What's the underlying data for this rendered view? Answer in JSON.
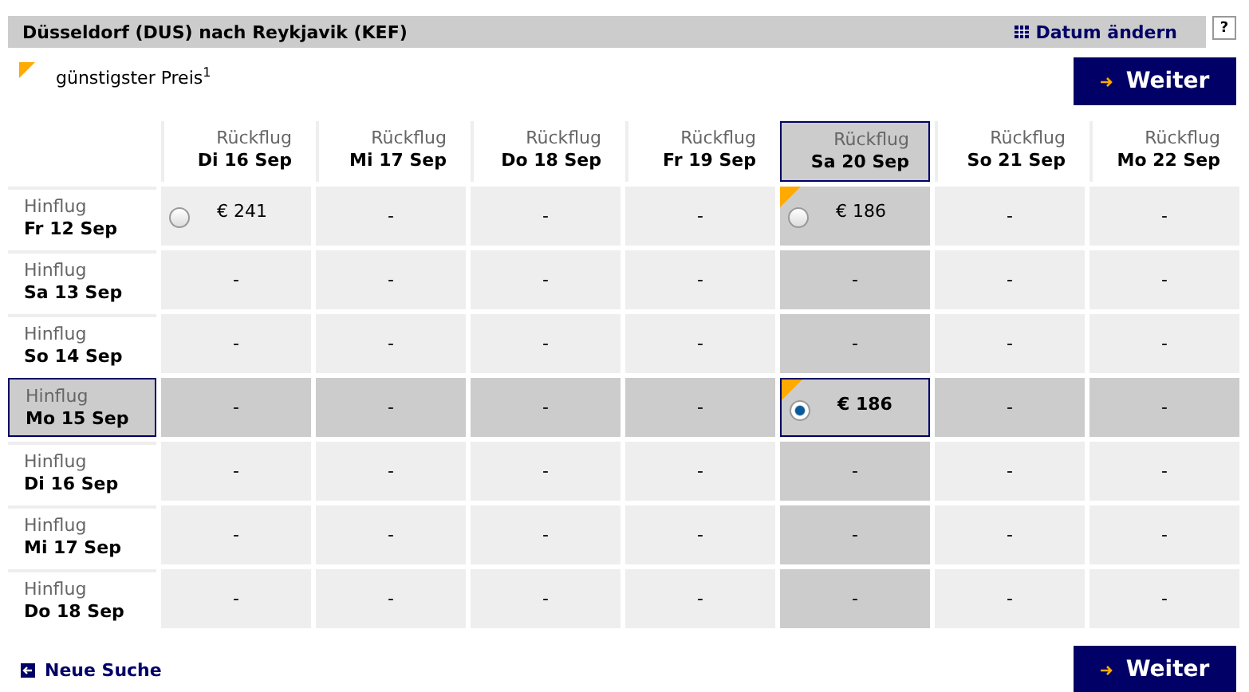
{
  "header": {
    "title": "Düsseldorf (DUS) nach Reykjavik (KEF)",
    "change_date": "Datum ändern",
    "help": "?"
  },
  "legend": {
    "text": "günstigster Preis$^{1}$"
  },
  "continue_top": "Weiter",
  "columns": [
    {
      "label": "Rückflug",
      "date": "Di 16 Sep",
      "selected": false
    },
    {
      "label": "Rückflug",
      "date": "Mi 17 Sep",
      "selected": false
    },
    {
      "label": "Rückflug",
      "date": "Do 18 Sep",
      "selected": false
    },
    {
      "label": "Rückflug",
      "date": "Fr 19 Sep",
      "selected": false
    },
    {
      "label": "Rückflug",
      "date": "Sa 20 Sep",
      "selected": true
    },
    {
      "label": "Rückflug",
      "date": "So 21 Sep",
      "selected": false
    },
    {
      "label": "Rückflug",
      "date": "Mo 22 Sep",
      "selected": false
    }
  ],
  "rows": [
    {
      "label": "Hinflug",
      "date": "Fr 12 Sep",
      "selected": false,
      "cells": [
        {
          "kind": "fare",
          "price": "€ 241",
          "cheapest": false,
          "selected": false
        },
        {
          "kind": "empty",
          "text": "-"
        },
        {
          "kind": "empty",
          "text": "-"
        },
        {
          "kind": "empty",
          "text": "-"
        },
        {
          "kind": "fare",
          "price": "€ 186",
          "cheapest": true,
          "selected": false
        },
        {
          "kind": "empty",
          "text": "-"
        },
        {
          "kind": "empty",
          "text": "-"
        }
      ]
    },
    {
      "label": "Hinflug",
      "date": "Sa 13 Sep",
      "selected": false,
      "cells": [
        {
          "kind": "empty",
          "text": "-"
        },
        {
          "kind": "empty",
          "text": "-"
        },
        {
          "kind": "empty",
          "text": "-"
        },
        {
          "kind": "empty",
          "text": "-"
        },
        {
          "kind": "empty",
          "text": "-"
        },
        {
          "kind": "empty",
          "text": "-"
        },
        {
          "kind": "empty",
          "text": "-"
        }
      ]
    },
    {
      "label": "Hinflug",
      "date": "So 14 Sep",
      "selected": false,
      "cells": [
        {
          "kind": "empty",
          "text": "-"
        },
        {
          "kind": "empty",
          "text": "-"
        },
        {
          "kind": "empty",
          "text": "-"
        },
        {
          "kind": "empty",
          "text": "-"
        },
        {
          "kind": "empty",
          "text": "-"
        },
        {
          "kind": "empty",
          "text": "-"
        },
        {
          "kind": "empty",
          "text": "-"
        }
      ]
    },
    {
      "label": "Hinflug",
      "date": "Mo 15 Sep",
      "selected": true,
      "cells": [
        {
          "kind": "empty",
          "text": "-"
        },
        {
          "kind": "empty",
          "text": "-"
        },
        {
          "kind": "empty",
          "text": "-"
        },
        {
          "kind": "empty",
          "text": "-"
        },
        {
          "kind": "fare",
          "price": "€ 186",
          "cheapest": true,
          "selected": true
        },
        {
          "kind": "empty",
          "text": "-"
        },
        {
          "kind": "empty",
          "text": "-"
        }
      ]
    },
    {
      "label": "Hinflug",
      "date": "Di 16 Sep",
      "selected": false,
      "cells": [
        {
          "kind": "empty",
          "text": "-"
        },
        {
          "kind": "empty",
          "text": "-"
        },
        {
          "kind": "empty",
          "text": "-"
        },
        {
          "kind": "empty",
          "text": "-"
        },
        {
          "kind": "empty",
          "text": "-"
        },
        {
          "kind": "empty",
          "text": "-"
        },
        {
          "kind": "empty",
          "text": "-"
        }
      ]
    },
    {
      "label": "Hinflug",
      "date": "Mi 17 Sep",
      "selected": false,
      "cells": [
        {
          "kind": "empty",
          "text": "-"
        },
        {
          "kind": "empty",
          "text": "-"
        },
        {
          "kind": "empty",
          "text": "-"
        },
        {
          "kind": "empty",
          "text": "-"
        },
        {
          "kind": "empty",
          "text": "-"
        },
        {
          "kind": "empty",
          "text": "-"
        },
        {
          "kind": "empty",
          "text": "-"
        }
      ]
    },
    {
      "label": "Hinflug",
      "date": "Do 18 Sep",
      "selected": false,
      "cells": [
        {
          "kind": "empty",
          "text": "-"
        },
        {
          "kind": "empty",
          "text": "-"
        },
        {
          "kind": "empty",
          "text": "-"
        },
        {
          "kind": "empty",
          "text": "-"
        },
        {
          "kind": "empty",
          "text": "-"
        },
        {
          "kind": "empty",
          "text": "-"
        },
        {
          "kind": "empty",
          "text": "-"
        }
      ]
    }
  ],
  "new_search": "Neue Suche",
  "continue_bottom": "Weiter"
}
